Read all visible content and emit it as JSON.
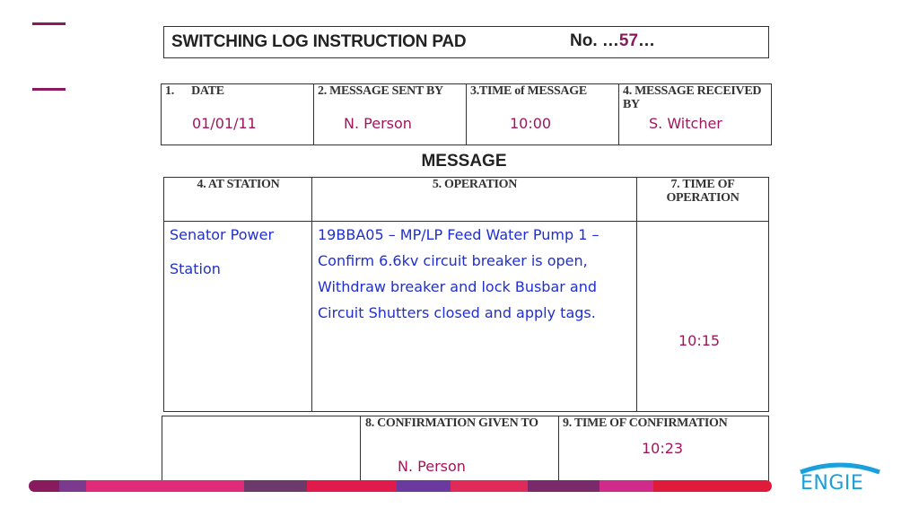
{
  "title": "SWITCHING LOG INSTRUCTION PAD",
  "no_label": "No. …",
  "no_value": "57",
  "no_suffix": "…",
  "header": {
    "date_label": "1.      DATE",
    "date_value": "01/01/11",
    "sent_label": "2. MESSAGE SENT BY",
    "sent_value": "N. Person",
    "time_label": "3.TIME of MESSAGE",
    "time_value": "10:00",
    "received_label": "4. MESSAGE RECEIVED BY",
    "received_value": "S. Witcher"
  },
  "message_heading": "MESSAGE",
  "message": {
    "station_label": "4. AT STATION",
    "operation_label": "5. OPERATION",
    "time_label": "7. TIME OF OPERATION",
    "station_lines": [
      "Senator Power",
      "Station"
    ],
    "operation_lines": [
      "19BBA05 – MP/LP Feed Water Pump 1 –",
      "Confirm 6.6kv circuit breaker is open,",
      "Withdraw breaker and lock Busbar and",
      "Circuit Shutters closed  and apply tags."
    ],
    "time_value": "10:15"
  },
  "confirmation": {
    "given_label": "8. CONFIRMATION GIVEN TO",
    "given_value": "N. Person",
    "time_label": "9. TIME OF CONFIRMATION",
    "time_value": "10:23"
  },
  "logo_text": "ENGIE",
  "colors": {
    "accent": "#8a1a5e",
    "handwriting_red": "#a0165a",
    "handwriting_blue": "#1f2fd1",
    "logo": "#1aa0dc"
  }
}
